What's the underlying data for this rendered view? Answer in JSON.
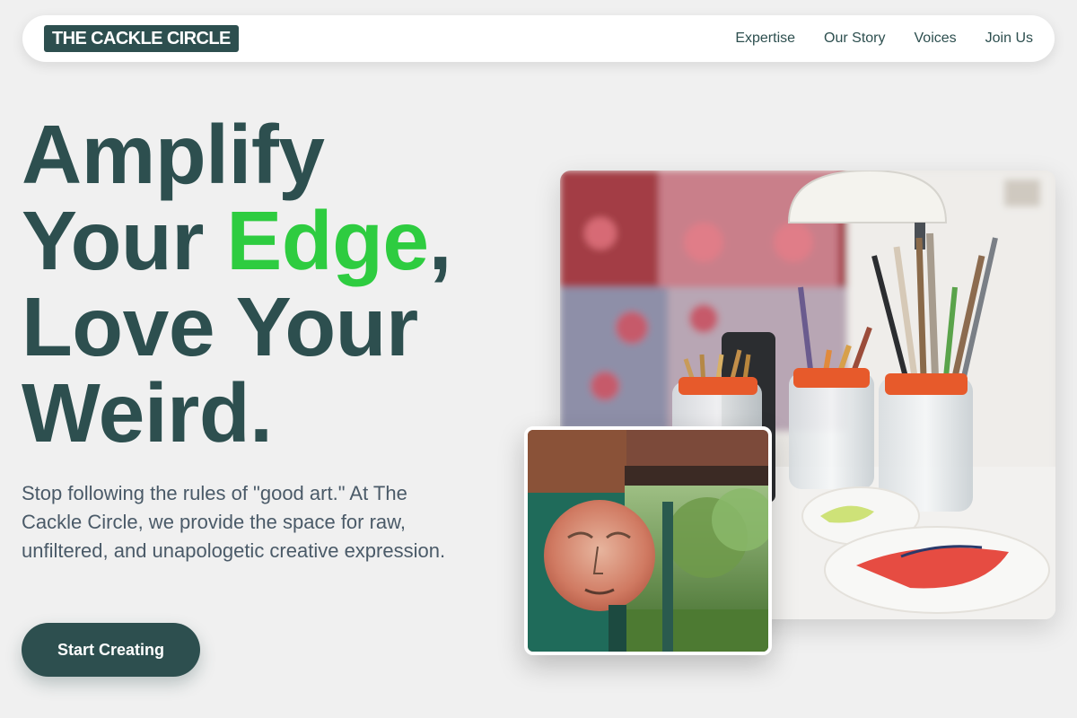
{
  "brand": {
    "logo_text": "THE CACKLE CIRCLE"
  },
  "nav": {
    "items": [
      {
        "label": "Expertise"
      },
      {
        "label": "Our Story"
      },
      {
        "label": "Voices"
      },
      {
        "label": "Join Us"
      }
    ]
  },
  "hero": {
    "title_line1": "Amplify",
    "title_line2_before": "Your ",
    "title_line2_accent": "Edge",
    "title_line2_after": ",",
    "title_line3": "Love Your",
    "title_line4": "Weird.",
    "subtitle": "Stop following the rules of \"good art.\" At The Cackle Circle, we provide the space for raw, unfiltered, and unapologetic creative expression.",
    "cta_label": "Start Creating"
  },
  "colors": {
    "primary": "#2d4f4f",
    "accent": "#2ecc40",
    "background": "#f0f0f0",
    "body_text": "#4a5a68"
  },
  "images": {
    "main": "paintbrushes-in-jars-photo",
    "inset": "painted-face-mural-photo"
  }
}
